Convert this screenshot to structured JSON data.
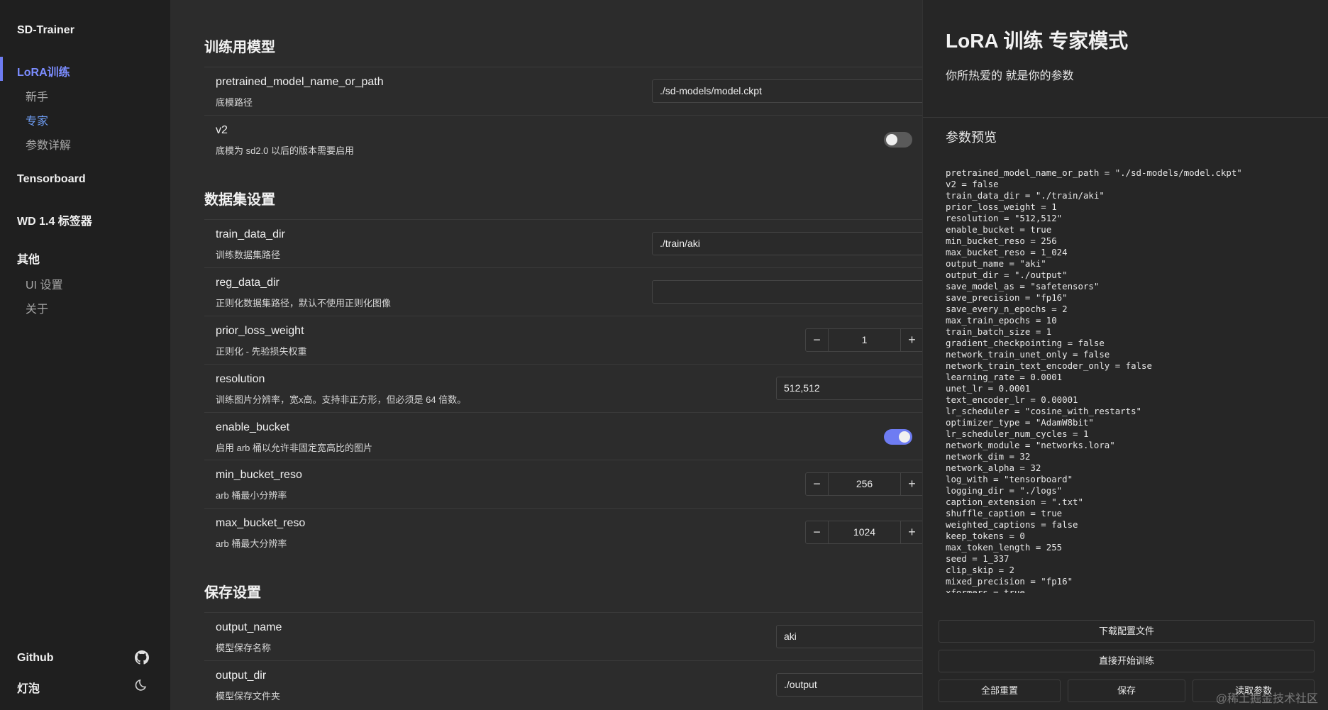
{
  "sidebar": {
    "brand": "SD-Trainer",
    "groups": [
      {
        "label": "LoRA训练",
        "items": [
          "新手",
          "专家",
          "参数详解"
        ]
      },
      {
        "label": "Tensorboard"
      },
      {
        "label": "WD 1.4 标签器"
      },
      {
        "label": "其他",
        "items": [
          "UI 设置",
          "关于"
        ]
      }
    ],
    "footer": {
      "github": "Github",
      "bulb": "灯泡"
    }
  },
  "sections": {
    "model": "训练用模型",
    "dataset": "数据集设置",
    "save": "保存设置"
  },
  "fields": {
    "pretrained": {
      "label": "pretrained_model_name_or_path",
      "desc": "底模路径",
      "value": "./sd-models/model.ckpt"
    },
    "v2": {
      "label": "v2",
      "desc": "底模为 sd2.0 以后的版本需要启用",
      "enabled": false
    },
    "train_data_dir": {
      "label": "train_data_dir",
      "desc": "训练数据集路径",
      "value": "./train/aki"
    },
    "reg_data_dir": {
      "label": "reg_data_dir",
      "desc": "正则化数据集路径，默认不使用正则化图像",
      "value": ""
    },
    "prior_loss_weight": {
      "label": "prior_loss_weight",
      "desc": "正则化 - 先验损失权重",
      "value": "1"
    },
    "resolution": {
      "label": "resolution",
      "desc": "训练图片分辨率，宽x高。支持非正方形，但必须是 64 倍数。",
      "value": "512,512"
    },
    "enable_bucket": {
      "label": "enable_bucket",
      "desc": "启用 arb 桶以允许非固定宽高比的图片",
      "enabled": true
    },
    "min_bucket_reso": {
      "label": "min_bucket_reso",
      "desc": "arb 桶最小分辨率",
      "value": "256"
    },
    "max_bucket_reso": {
      "label": "max_bucket_reso",
      "desc": "arb 桶最大分辨率",
      "value": "1024"
    },
    "output_name": {
      "label": "output_name",
      "desc": "模型保存名称",
      "value": "aki"
    },
    "output_dir": {
      "label": "output_dir",
      "desc": "模型保存文件夹",
      "value": "./output"
    }
  },
  "stepper": {
    "minus": "−",
    "plus": "+"
  },
  "right": {
    "title": "LoRA 训练 专家模式",
    "subtitle": "你所热爱的 就是你的参数",
    "preview_title": "参数预览",
    "preview_text": "pretrained_model_name_or_path = \"./sd-models/model.ckpt\"\nv2 = false\ntrain_data_dir = \"./train/aki\"\nprior_loss_weight = 1\nresolution = \"512,512\"\nenable_bucket = true\nmin_bucket_reso = 256\nmax_bucket_reso = 1_024\noutput_name = \"aki\"\noutput_dir = \"./output\"\nsave_model_as = \"safetensors\"\nsave_precision = \"fp16\"\nsave_every_n_epochs = 2\nmax_train_epochs = 10\ntrain_batch_size = 1\ngradient_checkpointing = false\nnetwork_train_unet_only = false\nnetwork_train_text_encoder_only = false\nlearning_rate = 0.0001\nunet_lr = 0.0001\ntext_encoder_lr = 0.00001\nlr_scheduler = \"cosine_with_restarts\"\noptimizer_type = \"AdamW8bit\"\nlr_scheduler_num_cycles = 1\nnetwork_module = \"networks.lora\"\nnetwork_dim = 32\nnetwork_alpha = 32\nlog_with = \"tensorboard\"\nlogging_dir = \"./logs\"\ncaption_extension = \".txt\"\nshuffle_caption = true\nweighted_captions = false\nkeep_tokens = 0\nmax_token_length = 255\nseed = 1_337\nclip_skip = 2\nmixed_precision = \"fp16\"\nxformers = true",
    "buttons": {
      "download": "下载配置文件",
      "start": "直接开始训练",
      "reset": "全部重置",
      "save": "保存",
      "load": "读取参数"
    },
    "watermark": "@稀土掘金技术社区"
  },
  "colors": {
    "accent": "#6e7cf2",
    "sidebar_bg": "#1f1f1f",
    "main_bg": "#2c2c2c",
    "panel_bg": "#262626"
  }
}
